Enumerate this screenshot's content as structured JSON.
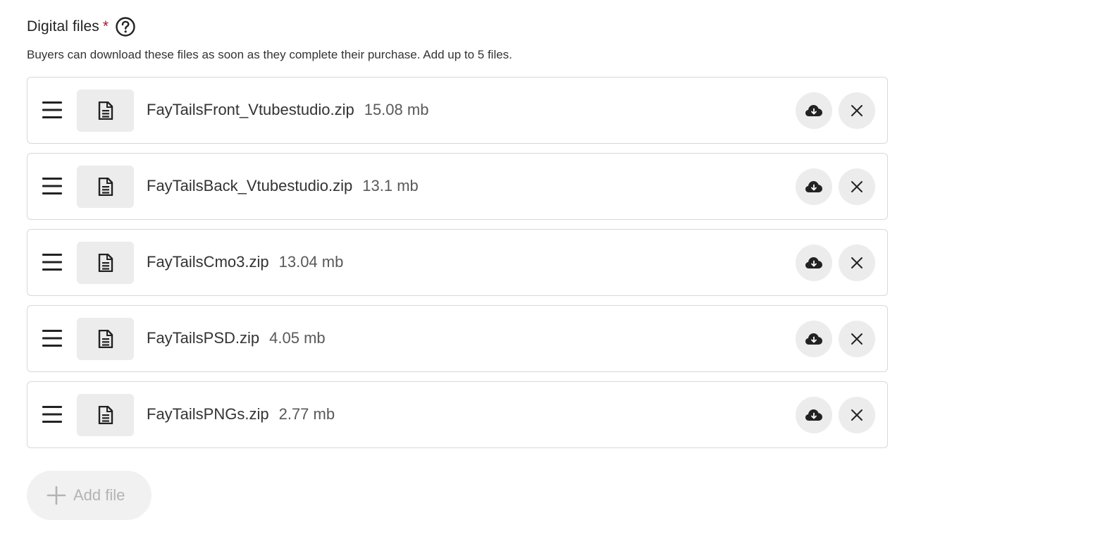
{
  "section": {
    "title": "Digital files",
    "required_marker": "*",
    "help_icon": "question-circle-icon",
    "subtitle": "Buyers can download these files as soon as they complete their purchase. Add up to 5 files."
  },
  "files": [
    {
      "name": "FayTailsFront_Vtubestudio.zip",
      "size": "15.08 mb"
    },
    {
      "name": "FayTailsBack_Vtubestudio.zip",
      "size": "13.1 mb"
    },
    {
      "name": "FayTailsCmo3.zip",
      "size": "13.04 mb"
    },
    {
      "name": "FayTailsPSD.zip",
      "size": "4.05 mb"
    },
    {
      "name": "FayTailsPNGs.zip",
      "size": "2.77 mb"
    }
  ],
  "icons": {
    "drag": "drag-handle-icon",
    "file": "document-icon",
    "download": "cloud-download-icon",
    "remove": "close-icon",
    "add": "plus-icon"
  },
  "add_button": {
    "label": "Add file"
  },
  "colors": {
    "required": "#a61a2e",
    "button_bg": "#ececec",
    "border": "#d8d8d8",
    "disabled_text": "#b3b3b3"
  }
}
